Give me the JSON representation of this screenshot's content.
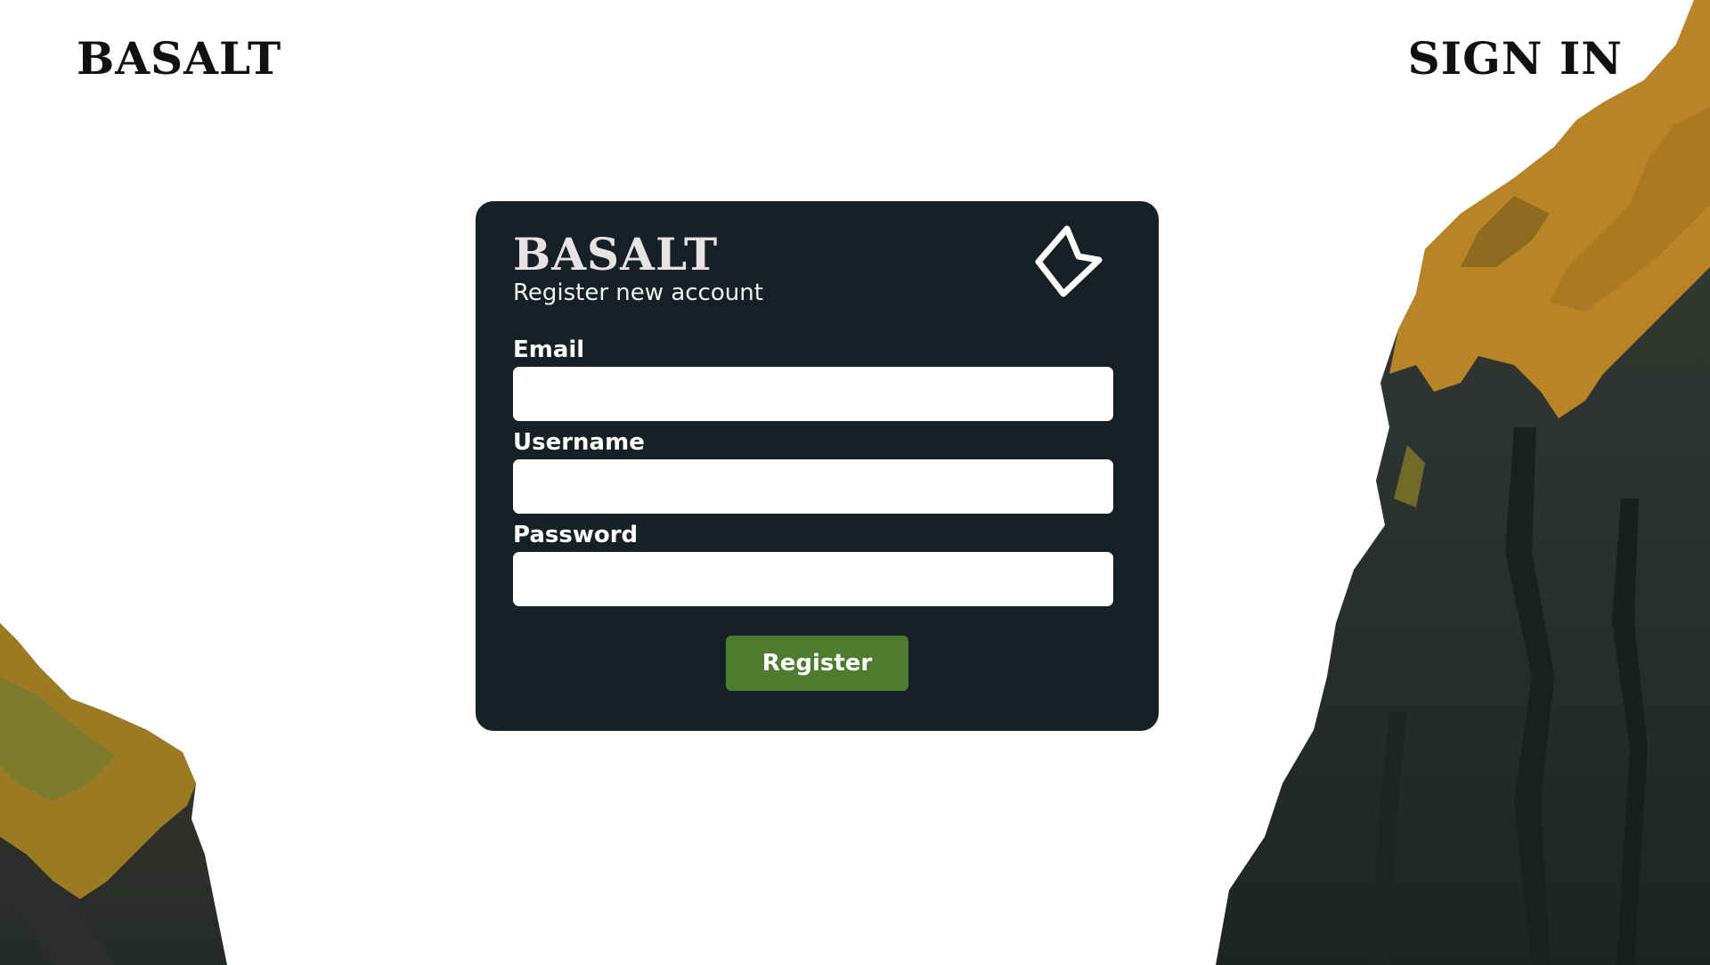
{
  "header": {
    "brand": "BASALT",
    "sign_in": "SIGN IN"
  },
  "card": {
    "brand": "BASALT",
    "subtitle": "Register new account",
    "fields": [
      {
        "label": "Email",
        "value": "",
        "placeholder": ""
      },
      {
        "label": "Username",
        "value": "",
        "placeholder": ""
      },
      {
        "label": "Password",
        "value": "",
        "placeholder": ""
      }
    ],
    "submit_label": "Register"
  },
  "colors": {
    "card_bg": "#152126",
    "button_bg": "#4d7c2f",
    "moss": "#c08a2a",
    "rock": "#2f3432"
  }
}
